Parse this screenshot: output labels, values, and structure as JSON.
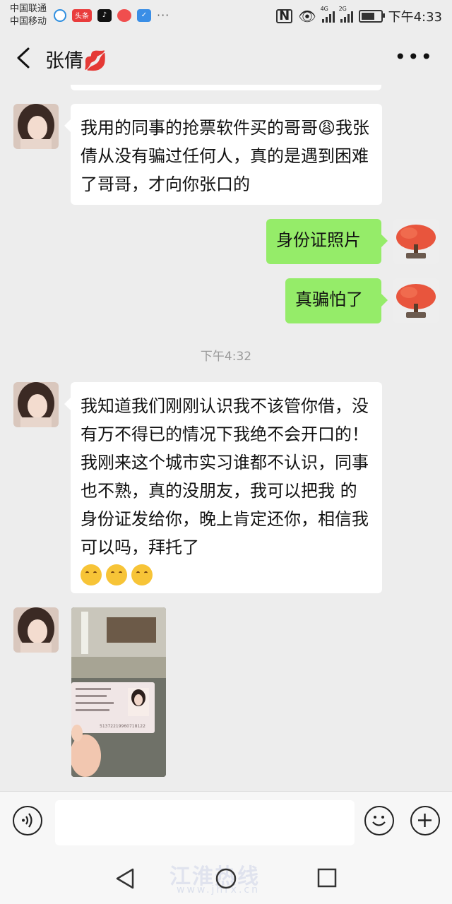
{
  "status_bar": {
    "carrier_1": "中国联通",
    "carrier_2": "中国移动",
    "app_toutiao": "头条",
    "overflow": "···",
    "net_1": "4G",
    "net_2": "2G",
    "time": "下午4:33"
  },
  "header": {
    "contact_name": "张倩💋"
  },
  "messages": [
    {
      "side": "in",
      "text": "我用的同事的抢票软件买的哥哥😩我张倩从没有骗过任何人，真的是遇到困难了哥哥，才向你张口的"
    },
    {
      "side": "out",
      "text": "身份证照片"
    },
    {
      "side": "out",
      "text": "真骗怕了"
    },
    {
      "type": "time",
      "text": "下午4:32"
    },
    {
      "side": "in",
      "text": "我知道我们刚刚认识我不该管你借，没有万不得已的情况下我绝不会开口的！我刚来这个城市实习谁都不认识，同事也不熟，真的没朋友，我可以把我 的身份证发给你，晚上肯定还你，相信我可以吗，拜托了"
    },
    {
      "side": "in",
      "type": "image",
      "icon": "id-card-photo"
    }
  ],
  "id_card_number": "51372219960718122",
  "input_bar": {
    "text_value": ""
  },
  "watermark": {
    "line1": "江淮热线",
    "line2": "www.jhrx.cn"
  },
  "colors": {
    "out_bubble": "#95ec69",
    "in_bubble": "#ffffff",
    "background": "#ededed"
  }
}
